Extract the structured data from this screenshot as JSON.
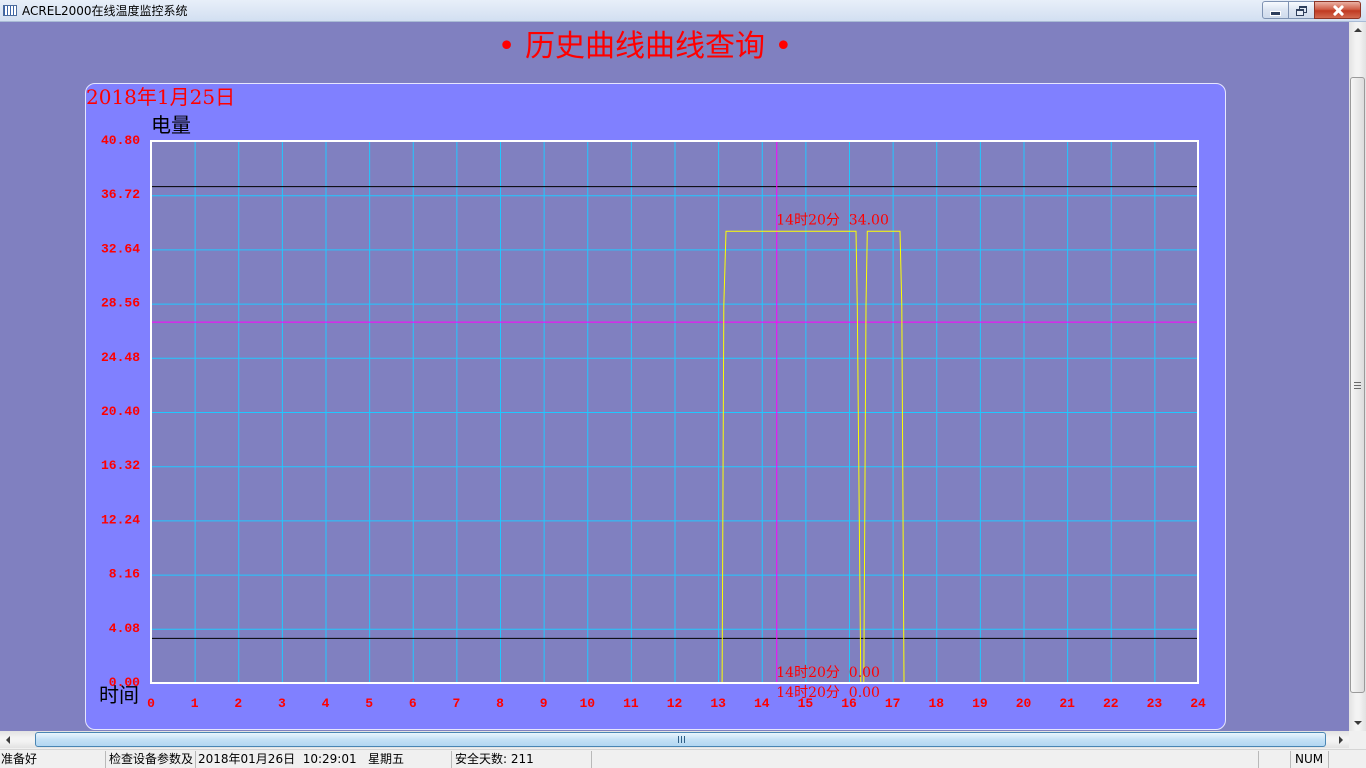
{
  "window": {
    "title": "ACREL2000在线温度监控系统",
    "app_icon": "app-icon",
    "buttons": {
      "minimize": "minimize-icon",
      "restore": "restore-icon",
      "close": "close-icon"
    }
  },
  "page": {
    "title": "• 历史曲线曲线查询 •"
  },
  "colors": {
    "background": "#8080C0",
    "panel": "#8080FF",
    "plot_background": "#8080C0",
    "plot_border": "#FFFFFF",
    "grid": "#20C8FF",
    "axis_text": "#FF0000",
    "heading_text": "#FF0000"
  },
  "chart_data": {
    "type": "line",
    "date": "2018年1月25日",
    "ylabel": "电量",
    "xlabel": "时间",
    "xlim": [
      0,
      24
    ],
    "ylim": [
      0,
      40.8
    ],
    "x_ticks": [
      0,
      1,
      2,
      3,
      4,
      5,
      6,
      7,
      8,
      9,
      10,
      11,
      12,
      13,
      14,
      15,
      16,
      17,
      18,
      19,
      20,
      21,
      22,
      23,
      24
    ],
    "y_tick_labels": [
      "40.80",
      "36.72",
      "32.64",
      "28.56",
      "24.48",
      "20.40",
      "16.32",
      "12.24",
      "8.16",
      "4.08",
      "0.00"
    ],
    "grid": true,
    "series": [
      {
        "color": "#FFFF00",
        "x": [
          13.09,
          13.13,
          13.18,
          16.16,
          16.19,
          16.27,
          16.34,
          16.39,
          16.42,
          17.17,
          17.21,
          17.26
        ],
        "y": [
          0,
          28.4,
          34,
          34,
          28.4,
          0,
          0,
          28.4,
          34,
          34,
          28.4,
          0
        ]
      }
    ],
    "reference_lines": [
      {
        "y": 37.4,
        "color": "#000000"
      },
      {
        "y": 3.4,
        "color": "#000000"
      }
    ],
    "cursor": {
      "x": 14.333,
      "y": 27.2,
      "color": "#FF00FF",
      "readouts": [
        {
          "text": "14时20分  34.00",
          "value": 34
        },
        {
          "text": "14时20分  0.00",
          "value": 0
        },
        {
          "text": "14时20分  0.00",
          "value": 0
        }
      ]
    }
  },
  "scrollbars": {
    "vertical": {
      "up": "arrow-up-icon",
      "down": "arrow-down-icon",
      "grip": "grip-icon"
    },
    "horizontal": {
      "left": "arrow-left-icon",
      "right": "arrow-right-icon",
      "grip": "grip-icon"
    }
  },
  "status_bar": {
    "ready": "准备好",
    "message": "检查设备参数及",
    "datetime": "2018年01月26日  10:29:01   星期五",
    "safe_days": "安全天数: 211",
    "num_lock": "NUM"
  }
}
